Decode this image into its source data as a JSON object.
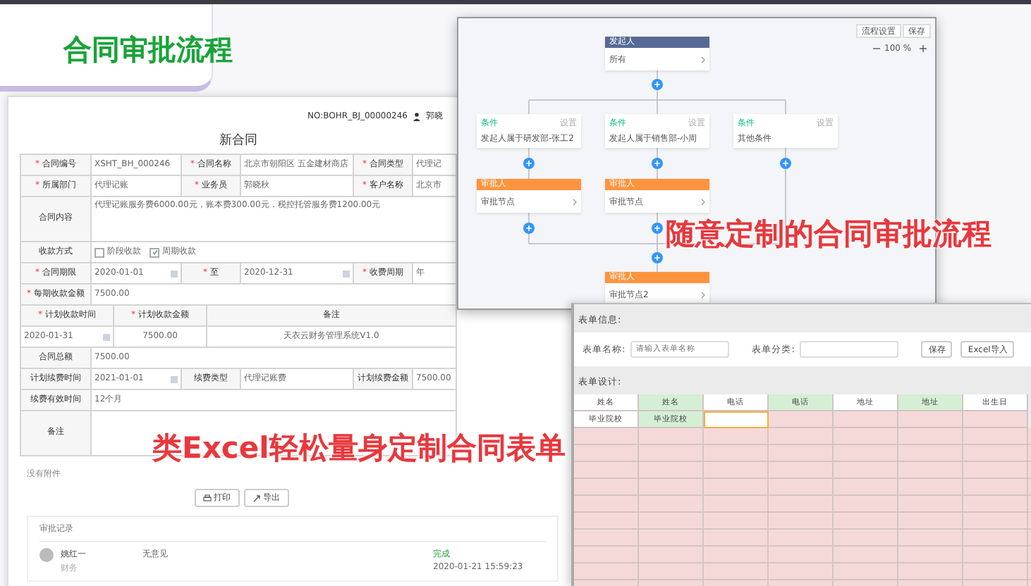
{
  "page_title": "合同审批流程",
  "captions": [
    {
      "text": "随意定制的合同审批流程",
      "kind": "flow"
    },
    {
      "text": "类Excel轻松量身定制合同表单",
      "kind": "form"
    }
  ],
  "contract": {
    "number": "NO:BOHR_BJ_00000246",
    "user": "郭晓",
    "title": "新合同",
    "rows": [
      {
        "kind": "fields",
        "fields": [
          {
            "label": "合同编号",
            "mark": "*",
            "value": "XSHT_BH_000246"
          },
          {
            "label": "合同名称",
            "mark": "*",
            "value": "北京市朝阳区 五金建材商店"
          },
          {
            "label": "合同类型",
            "mark": "*",
            "value": "代理记"
          }
        ]
      },
      {
        "kind": "fields",
        "fields": [
          {
            "label": "所属部门",
            "mark": "*",
            "value": "代理记账"
          },
          {
            "label": "业务员",
            "mark": "*",
            "value": "郭晓秋"
          },
          {
            "label": "客户名称",
            "mark": "*",
            "value": "北京市"
          }
        ]
      },
      {
        "kind": "text",
        "label": "合同内容",
        "value": "代理记账服务费6000.00元，账本费300.00元，税控托管服务费1200.00元"
      },
      {
        "kind": "checks",
        "label": "收款方式",
        "options": [
          {
            "label": "阶段收款",
            "checked": false
          },
          {
            "label": "周期收款",
            "checked": true
          }
        ]
      },
      {
        "kind": "fields",
        "fields": [
          {
            "label": "合同期限",
            "mark": "*",
            "value": "2020-01-01",
            "date": true
          },
          {
            "label": "至",
            "mark": "*",
            "value": "2020-12-31",
            "date": true
          },
          {
            "label": "收费周期",
            "mark": "*",
            "value": "年"
          }
        ]
      },
      {
        "kind": "fields",
        "fields": [
          {
            "label": "每期收款金额",
            "mark": "*",
            "value": "7500.00"
          }
        ]
      },
      {
        "kind": "schedule_header",
        "cells": [
          {
            "text": "计划收款时间",
            "mark": "*"
          },
          {
            "text": "计划收款金额",
            "mark": "*"
          },
          {
            "text": "备注"
          }
        ]
      },
      {
        "kind": "schedule_row",
        "cells": [
          {
            "text": "2020-01-31",
            "date": true
          },
          {
            "text": "7500.00"
          },
          {
            "text": "天衣云财务管理系统V1.0"
          }
        ]
      },
      {
        "kind": "fields",
        "fields": [
          {
            "label": "合同总额",
            "value": "7500.00"
          }
        ]
      },
      {
        "kind": "fields",
        "fields": [
          {
            "label": "计划续费时间",
            "value": "2021-01-01",
            "date": true
          },
          {
            "label": "续费类型",
            "value": "代理记账费"
          },
          {
            "label": "计划续费金额",
            "value": "7500.00"
          }
        ]
      },
      {
        "kind": "fields",
        "fields": [
          {
            "label": "续费有效时间",
            "value": "12个月"
          }
        ]
      },
      {
        "kind": "text",
        "label": "备注"
      }
    ],
    "attachments": "没有附件",
    "buttons": [
      {
        "label": "打印",
        "kind": "print"
      },
      {
        "label": "导出",
        "kind": "export"
      }
    ],
    "record": {
      "title": "审批记录",
      "name": "姚红一",
      "role": "财务",
      "comment": "无意见",
      "status": "完成",
      "time": "2020-01-21 15:59:23"
    }
  },
  "flow": {
    "buttons": [
      "流程设置",
      "保存"
    ],
    "zoom": "100 %",
    "start": {
      "header": "发起人",
      "body": "所有"
    },
    "branches": [
      {
        "tag": "条件",
        "priority": "设置",
        "text": "发起人属于研发部-张工2",
        "approver": {
          "header": "审批人",
          "body": "审批节点"
        }
      },
      {
        "tag": "条件",
        "priority": "设置",
        "text": "发起人属于销售部-小周",
        "approver": {
          "header": "审批人",
          "body": "审批节点"
        }
      },
      {
        "tag": "条件",
        "priority": "设置",
        "text": "其他条件"
      }
    ],
    "end": {
      "header": "审批人",
      "body": "审批节点2"
    }
  },
  "form": {
    "info_title": "表单信息:",
    "name_label": "表单名称:",
    "name_placeholder": "请输入表单名称",
    "category_label": "表单分类:",
    "buttons": [
      "保存",
      "Excel导入"
    ],
    "design_title": "表单设计:",
    "columns": [
      {
        "text": "姓名",
        "highlight": false
      },
      {
        "text": "姓名",
        "highlight": true
      },
      {
        "text": "电话",
        "highlight": false
      },
      {
        "text": "电话",
        "highlight": true
      },
      {
        "text": "地址",
        "highlight": false
      },
      {
        "text": "地址",
        "highlight": true
      },
      {
        "text": "出生日",
        "highlight": false
      }
    ],
    "rows": [
      {
        "cells": [
          {
            "text": "毕业院校",
            "selected": false
          },
          {
            "text": "毕业院校",
            "selected": false
          },
          {
            "selected": true
          }
        ]
      }
    ]
  }
}
